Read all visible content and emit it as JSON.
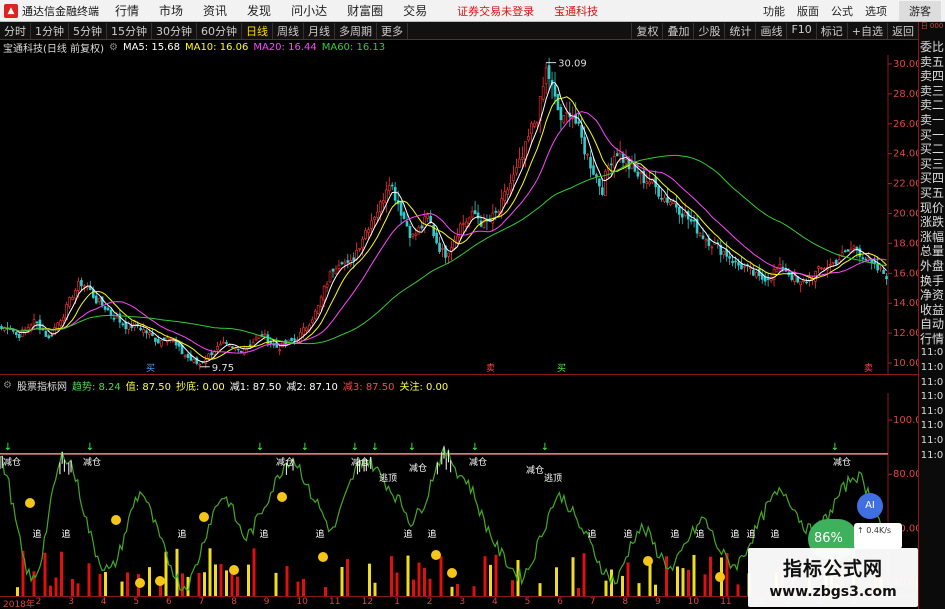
{
  "menubar": {
    "app_name": "通达信金融终端",
    "menus": [
      "行情",
      "市场",
      "资讯",
      "发现",
      "问小达",
      "财富圈",
      "交易"
    ],
    "warning": "证券交易未登录",
    "stock_name": "宝通科技",
    "right_items": [
      "功能",
      "版面",
      "公式",
      "选项"
    ],
    "guest": "游客"
  },
  "periods": [
    "分时",
    "1分钟",
    "5分钟",
    "15分钟",
    "30分钟",
    "60分钟",
    "日线",
    "周线",
    "月线",
    "多周期",
    "更多"
  ],
  "active_period": "日线",
  "tools": [
    "复权",
    "叠加",
    "少股",
    "统计",
    "画线",
    "F10",
    "标记",
    "+自选",
    "返回"
  ],
  "main_info": {
    "title": "宝通科技(日线 前复权)",
    "ma5": "MA5: 15.68",
    "ma10": "MA10: 16.06",
    "ma20": "MA20: 16.44",
    "ma60": "MA60: 16.13"
  },
  "ind_info": {
    "name": "股票指标网",
    "trend": "趋势: 8.24",
    "value": "值: 87.50",
    "chaodi": "抄底: 0.00",
    "jian1": "减1: 87.50",
    "jian2": "减2: 87.10",
    "jian3": "减3: 87.50",
    "guanzhu": "关注: 0.00"
  },
  "side_items": [
    "委比",
    "卖五",
    "卖四",
    "卖三",
    "卖二",
    "卖一",
    "买一",
    "买二",
    "买三",
    "买四",
    "买五",
    "现价",
    "涨跌",
    "涨幅",
    "总量",
    "外盘",
    "换手",
    "净资",
    "收益",
    "自动",
    "行情"
  ],
  "side_times": [
    "11:0",
    "11:0",
    "11:0",
    "11:0",
    "11:0",
    "11:0",
    "11:0",
    "11:0"
  ],
  "side_top": "日\n000",
  "main_axis": [
    "30.00",
    "28.00",
    "26.00",
    "24.00",
    "22.00",
    "20.00",
    "18.00",
    "16.00",
    "14.00",
    "12.00",
    "10.00"
  ],
  "ind_axis": [
    "100.0",
    "80.00",
    "60.00",
    "40.00"
  ],
  "price_high_label": "30.09",
  "price_low_label": "9.75",
  "signal_labels": {
    "buy": "买",
    "sell": "卖",
    "jian": "减仓",
    "taoyun": "逃顶",
    "zhui": "追"
  },
  "date_axis": [
    "2018年",
    "2",
    "3",
    "4",
    "5",
    "6",
    "7",
    "8",
    "9",
    "10",
    "11",
    "12",
    "1",
    "2",
    "3",
    "4",
    "5",
    "6",
    "7",
    "8",
    "9",
    "10",
    "11",
    "12",
    "1",
    "2",
    "3"
  ],
  "watermark": {
    "line1": "指标公式网",
    "line2": "www.zbgs3.com"
  },
  "ai_label": "AI",
  "speed_label": "86%",
  "net_label": "0.4K/s",
  "colors": {
    "ma5": "#ffffff",
    "ma10": "#ffff00",
    "ma20": "#ff44ff",
    "ma60": "#33cc33",
    "up": "#ff3333",
    "down": "#33cccc",
    "indicator": "#44aa22",
    "threshold": "#ff8888"
  },
  "chart_data": {
    "type": "candlestick",
    "price_range": [
      9.2,
      30.6
    ],
    "close_path": [
      12.3,
      12.5,
      11.8,
      12.2,
      12.8,
      12.4,
      11.6,
      12.6,
      13.4,
      14.6,
      15.4,
      15.0,
      14.2,
      13.8,
      13.2,
      12.8,
      12.4,
      12.6,
      12.2,
      11.8,
      11.4,
      11.9,
      11.2,
      10.6,
      10.2,
      9.9,
      10.4,
      10.9,
      11.2,
      11.0,
      10.9,
      11.1,
      11.5,
      11.9,
      11.4,
      11.0,
      11.3,
      11.5,
      12.0,
      12.8,
      13.6,
      15.2,
      16.4,
      17.0,
      16.4,
      17.6,
      18.8,
      19.8,
      20.6,
      22.4,
      21.0,
      19.6,
      18.4,
      19.0,
      19.8,
      18.2,
      17.2,
      18.0,
      19.2,
      19.6,
      20.0,
      19.2,
      19.6,
      20.2,
      21.6,
      22.6,
      23.8,
      25.6,
      26.8,
      29.8,
      27.6,
      26.0,
      27.0,
      25.6,
      24.0,
      22.8,
      21.6,
      23.6,
      24.2,
      23.4,
      22.8,
      22.4,
      22.2,
      21.6,
      21.0,
      20.8,
      20.2,
      19.6,
      19.0,
      18.4,
      18.0,
      17.6,
      17.2,
      16.6,
      16.4,
      16.0,
      15.6,
      15.8,
      16.2,
      16.4,
      15.8,
      15.2,
      15.6,
      16.0,
      16.4,
      16.6,
      17.0,
      17.4,
      17.8,
      17.2,
      16.6,
      16.2,
      15.9
    ],
    "indicator_range": [
      35,
      110
    ],
    "indicator_path": [
      87,
      78,
      62,
      48,
      40,
      46,
      62,
      78,
      88,
      84,
      74,
      62,
      52,
      46,
      44,
      50,
      60,
      70,
      74,
      66,
      58,
      50,
      44,
      38,
      40,
      48,
      58,
      66,
      72,
      70,
      62,
      56,
      60,
      66,
      72,
      78,
      84,
      86,
      82,
      74,
      70,
      64,
      58,
      66,
      74,
      82,
      86,
      84,
      80,
      76,
      72,
      68,
      62,
      66,
      72,
      82,
      88,
      86,
      80,
      78,
      72,
      64,
      58,
      52,
      48,
      44,
      42,
      46,
      54,
      62,
      70,
      72,
      68,
      62,
      58,
      52,
      46,
      42,
      40,
      48,
      56,
      60,
      58,
      52,
      48,
      44,
      50,
      56,
      60,
      64,
      58,
      52,
      48,
      46,
      50,
      56,
      62,
      68,
      72,
      74,
      70,
      64,
      60,
      58,
      62,
      66,
      72,
      76,
      80,
      78,
      72,
      64,
      58
    ],
    "indicator_threshold": 87.5
  }
}
